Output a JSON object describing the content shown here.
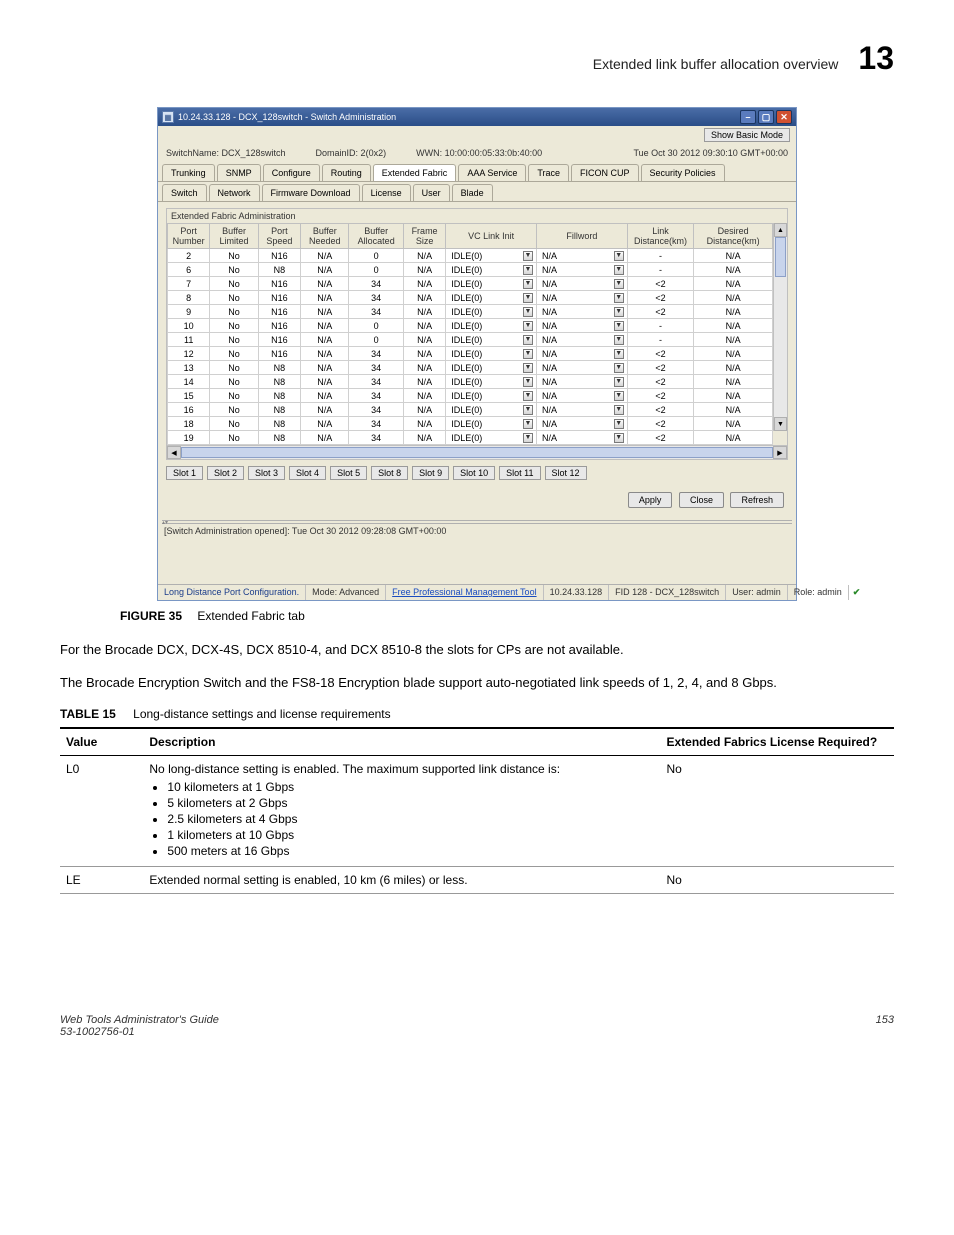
{
  "header": {
    "title": "Extended link buffer allocation overview",
    "chapter": "13"
  },
  "window": {
    "title": "10.24.33.128 - DCX_128switch - Switch Administration",
    "showBasicMode": "Show Basic Mode",
    "switchName": "SwitchName: DCX_128switch",
    "domainId": "DomainID: 2(0x2)",
    "wwn": "WWN: 10:00:00:05:33:0b:40:00",
    "datetime": "Tue Oct 30 2012 09:30:10 GMT+00:00",
    "tabs": [
      "Trunking",
      "SNMP",
      "Configure",
      "Routing",
      "Extended Fabric",
      "AAA Service",
      "Trace",
      "FICON CUP",
      "Security Policies"
    ],
    "tabs2": [
      "Switch",
      "Network",
      "Firmware Download",
      "License",
      "User",
      "Blade"
    ],
    "selectedTab": "Extended Fabric",
    "groupTitle": "Extended Fabric Administration",
    "columns": [
      "Port Number",
      "Buffer Limited",
      "Port Speed",
      "Buffer Needed",
      "Buffer Allocated",
      "Frame Size",
      "VC Link Init",
      "Fillword",
      "Link Distance(km)",
      "Desired Distance(km)"
    ],
    "slots": [
      "Slot 1",
      "Slot 2",
      "Slot 3",
      "Slot 4",
      "Slot 5",
      "Slot 8",
      "Slot 9",
      "Slot 10",
      "Slot 11",
      "Slot 12"
    ],
    "actions": {
      "apply": "Apply",
      "close": "Close",
      "refresh": "Refresh"
    },
    "log": "[Switch Administration opened]: Tue Oct 30 2012 09:28:08 GMT+00:00",
    "status": {
      "left": "Long Distance Port Configuration.",
      "mode": "Mode: Advanced",
      "tool": "Free Professional Management Tool",
      "ip": "10.24.33.128",
      "fid": "FID 128 - DCX_128switch",
      "user": "User: admin",
      "role": "Role: admin"
    }
  },
  "chart_data": {
    "type": "table",
    "columns": [
      "Port Number",
      "Buffer Limited",
      "Port Speed",
      "Buffer Needed",
      "Buffer Allocated",
      "Frame Size",
      "VC Link Init",
      "Fillword",
      "Link Distance(km)",
      "Desired Distance(km)"
    ],
    "rows": [
      [
        "2",
        "No",
        "N16",
        "N/A",
        "0",
        "N/A",
        "IDLE(0)",
        "N/A",
        "-",
        "N/A"
      ],
      [
        "6",
        "No",
        "N8",
        "N/A",
        "0",
        "N/A",
        "IDLE(0)",
        "N/A",
        "-",
        "N/A"
      ],
      [
        "7",
        "No",
        "N16",
        "N/A",
        "34",
        "N/A",
        "IDLE(0)",
        "N/A",
        "<2",
        "N/A"
      ],
      [
        "8",
        "No",
        "N16",
        "N/A",
        "34",
        "N/A",
        "IDLE(0)",
        "N/A",
        "<2",
        "N/A"
      ],
      [
        "9",
        "No",
        "N16",
        "N/A",
        "34",
        "N/A",
        "IDLE(0)",
        "N/A",
        "<2",
        "N/A"
      ],
      [
        "10",
        "No",
        "N16",
        "N/A",
        "0",
        "N/A",
        "IDLE(0)",
        "N/A",
        "-",
        "N/A"
      ],
      [
        "11",
        "No",
        "N16",
        "N/A",
        "0",
        "N/A",
        "IDLE(0)",
        "N/A",
        "-",
        "N/A"
      ],
      [
        "12",
        "No",
        "N16",
        "N/A",
        "34",
        "N/A",
        "IDLE(0)",
        "N/A",
        "<2",
        "N/A"
      ],
      [
        "13",
        "No",
        "N8",
        "N/A",
        "34",
        "N/A",
        "IDLE(0)",
        "N/A",
        "<2",
        "N/A"
      ],
      [
        "14",
        "No",
        "N8",
        "N/A",
        "34",
        "N/A",
        "IDLE(0)",
        "N/A",
        "<2",
        "N/A"
      ],
      [
        "15",
        "No",
        "N8",
        "N/A",
        "34",
        "N/A",
        "IDLE(0)",
        "N/A",
        "<2",
        "N/A"
      ],
      [
        "16",
        "No",
        "N8",
        "N/A",
        "34",
        "N/A",
        "IDLE(0)",
        "N/A",
        "<2",
        "N/A"
      ],
      [
        "18",
        "No",
        "N8",
        "N/A",
        "34",
        "N/A",
        "IDLE(0)",
        "N/A",
        "<2",
        "N/A"
      ],
      [
        "19",
        "No",
        "N8",
        "N/A",
        "34",
        "N/A",
        "IDLE(0)",
        "N/A",
        "<2",
        "N/A"
      ]
    ]
  },
  "figure": {
    "label": "FIGURE 35",
    "caption": "Extended Fabric tab"
  },
  "para1": "For the Brocade DCX, DCX-4S, DCX 8510-4, and DCX 8510-8 the slots for CPs are not available.",
  "para2": "The Brocade Encryption Switch and the FS8-18 Encryption blade support auto-negotiated link speeds of 1, 2, 4, and 8 Gbps.",
  "table15": {
    "label": "TABLE 15",
    "caption": "Long-distance settings and license requirements",
    "headers": [
      "Value",
      "Description",
      "Extended Fabrics License Required?"
    ],
    "rows": [
      {
        "value": "L0",
        "descLead": "No long-distance setting is enabled. The maximum supported link distance is:",
        "bullets": [
          "10 kilometers at 1 Gbps",
          "5 kilometers at 2 Gbps",
          "2.5 kilometers at 4 Gbps",
          "1 kilometers at 10 Gbps",
          "500 meters at 16 Gbps"
        ],
        "req": "No"
      },
      {
        "value": "LE",
        "descLead": "Extended normal setting is enabled, 10 km (6 miles) or less.",
        "bullets": [],
        "req": "No"
      }
    ]
  },
  "footer": {
    "left1": "Web Tools Administrator's Guide",
    "left2": "53-1002756-01",
    "page": "153"
  }
}
